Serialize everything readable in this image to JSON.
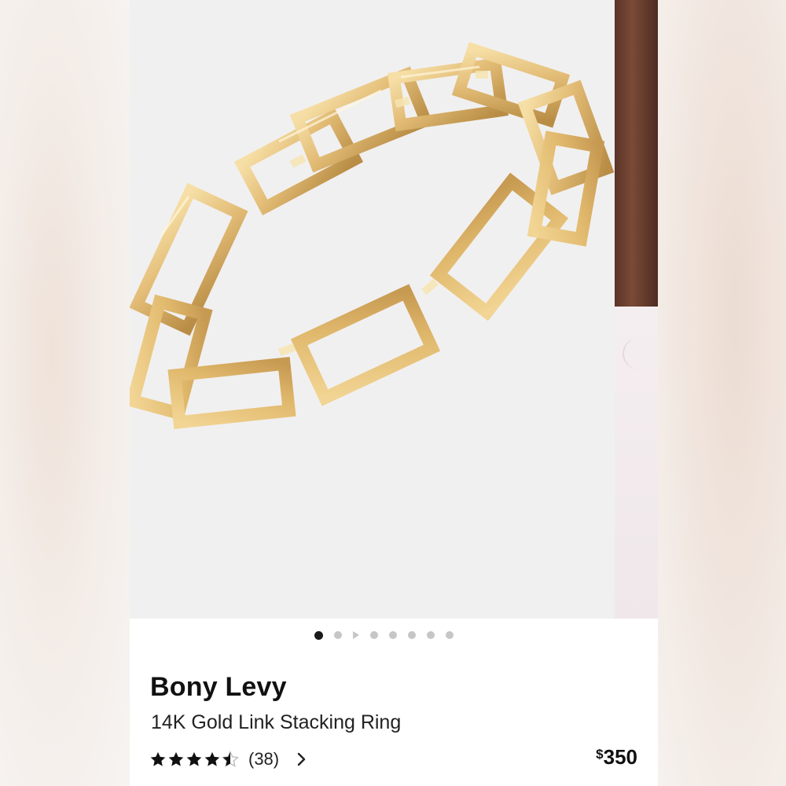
{
  "product": {
    "brand": "Bony Levy",
    "name": "14K Gold Link Stacking Ring",
    "rating": 4.5,
    "rating_max": 5,
    "review_count": "(38)",
    "price_currency": "$",
    "price_amount": "350"
  },
  "carousel": {
    "total_slides": 8,
    "active_index": 0,
    "video_slide_index": 2
  },
  "colors": {
    "gold": "#e3bd77",
    "gold_highlight": "#f6dfa6",
    "gold_shadow": "#b98d45",
    "dot_active": "#1a1a1a",
    "dot_inactive": "#c6c6c6"
  },
  "icons": {
    "star": "star-icon",
    "half_star": "half-star-icon",
    "chevron": "chevron-right-icon",
    "video_dot": "play-icon"
  }
}
